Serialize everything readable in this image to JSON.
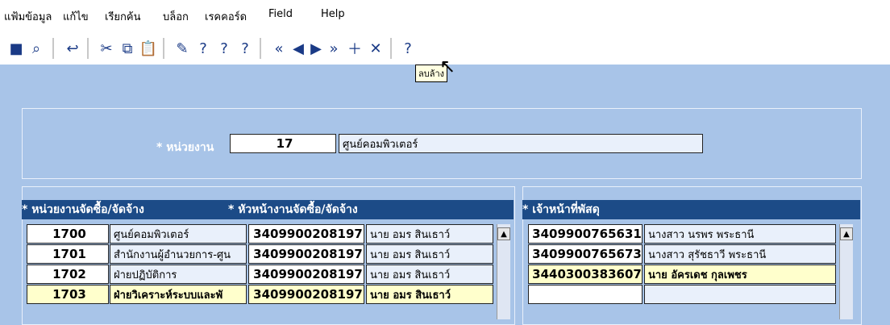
{
  "menu": [
    {
      "label": "แฟ้มข้อมูล"
    },
    {
      "label": "แก้ไข"
    },
    {
      "label": "เรียกค้น"
    },
    {
      "label": "บล็อก"
    },
    {
      "label": "เรคคอร์ด"
    },
    {
      "label": "Field"
    },
    {
      "label": "Help"
    }
  ],
  "toolbar": {
    "tooltip": "ลบล้าง"
  },
  "form": {
    "unit_label": "* หน่วยงาน",
    "unit_code": "17",
    "unit_name": "ศูนย์คอมพิวเตอร์"
  },
  "left_table": {
    "header1": "* หน่วยงานจัดซื้อ/จัดจ้าง",
    "header2": "* หัวหน้างานจัดซื้อ/จัดจ้าง",
    "rows": [
      {
        "code": "1700",
        "name": "ศูนย์คอมพิวเตอร์",
        "id": "3409900208197",
        "person": "นาย อมร สินเธาว์"
      },
      {
        "code": "1701",
        "name": "สำนักงานผู้อำนวยการ-ศูน",
        "id": "3409900208197",
        "person": "นาย อมร สินเธาว์"
      },
      {
        "code": "1702",
        "name": "ฝ่ายปฏิบัติการ",
        "id": "3409900208197",
        "person": "นาย อมร สินเธาว์"
      },
      {
        "code": "1703",
        "name": "ฝ่ายวิเคราะห์ระบบและพั",
        "id": "3409900208197",
        "person": "นาย อมร สินเธาว์"
      }
    ]
  },
  "right_table": {
    "header": "* เจ้าหน้าที่พัสดุ",
    "rows": [
      {
        "id": "3409900765631",
        "person": "นางสาว นรพร พระธานี"
      },
      {
        "id": "3409900765673",
        "person": "นางสาว สุรัชธาวี พระธานี"
      },
      {
        "id": "3440300383607",
        "person": "นาย อัครเดช กุลเพชร"
      },
      {
        "id": "",
        "person": ""
      }
    ]
  },
  "colors": {
    "background": "#a8c4e8",
    "header": "#1c4b87",
    "field": "#e9f0fb",
    "highlight": "#ffffcc"
  }
}
